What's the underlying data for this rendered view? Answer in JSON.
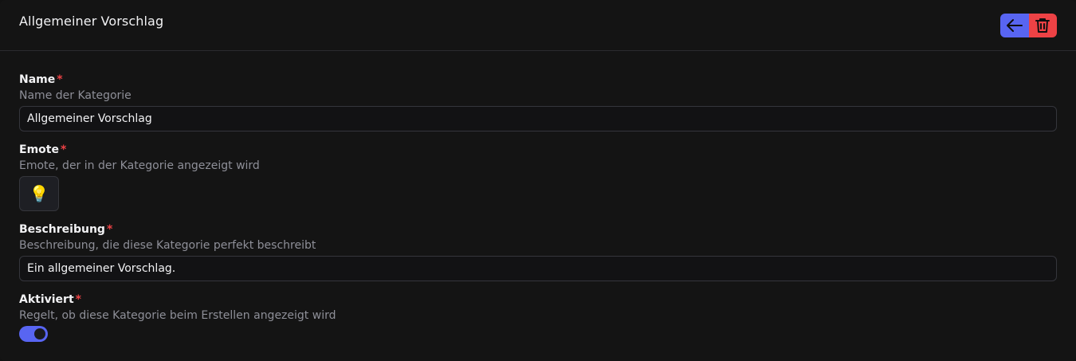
{
  "header": {
    "title": "Allgemeiner Vorschlag",
    "back_icon": "arrow-left-icon",
    "delete_icon": "trash-icon"
  },
  "fields": {
    "name": {
      "label": "Name",
      "required": "*",
      "description": "Name der Kategorie",
      "value": "Allgemeiner Vorschlag"
    },
    "emote": {
      "label": "Emote",
      "required": "*",
      "description": "Emote, der in der Kategorie angezeigt wird",
      "value": "💡"
    },
    "beschreibung": {
      "label": "Beschreibung",
      "required": "*",
      "description": "Beschreibung, die diese Kategorie perfekt beschreibt",
      "value": "Ein allgemeiner Vorschlag."
    },
    "aktiviert": {
      "label": "Aktiviert",
      "required": "*",
      "description": "Regelt, ob diese Kategorie beim Erstellen angezeigt wird",
      "value": true
    }
  },
  "colors": {
    "accent": "#5865f2",
    "danger": "#ed4245",
    "background": "#141414"
  }
}
